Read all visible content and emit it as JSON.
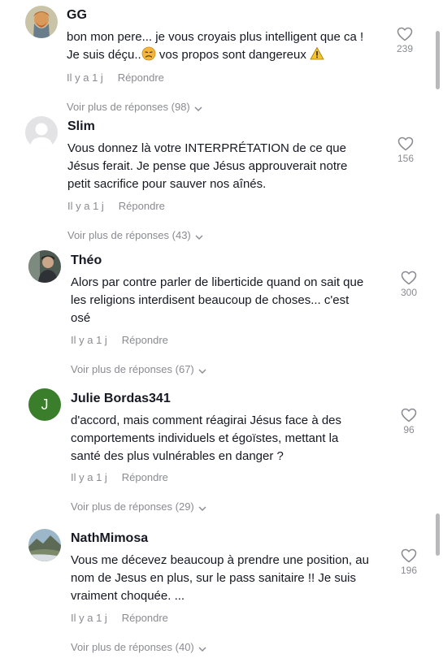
{
  "comments": [
    {
      "username": "GG",
      "line1": "bon mon pere... je vous croyais plus intelligent que ca !",
      "line2a": "Je suis déçu..",
      "line2b": " vos propos sont dangereux ",
      "emoji_1": "disappointed-face-icon",
      "emoji_2": "warning-icon",
      "time": "Il y a 1 j",
      "reply": "Répondre",
      "likes": "239",
      "more": "Voir plus de réponses (98)"
    },
    {
      "username": "Slim",
      "lines": [
        "Vous donnez là votre INTERPRÉTATION de ce que",
        "Jésus ferait. Je pense que Jésus approuverait notre",
        "petit sacrifice pour sauver nos aînés."
      ],
      "time": "Il y a 1 j",
      "reply": "Répondre",
      "likes": "156",
      "more": "Voir plus de réponses (43)"
    },
    {
      "username": "Théo",
      "lines": [
        "Alors par contre parler de liberticide quand on sait que",
        "les religions interdisent beaucoup de choses... c'est",
        "osé"
      ],
      "time": "Il y a 1 j",
      "reply": "Répondre",
      "likes": "300",
      "more": "Voir plus de réponses (67)"
    },
    {
      "username": "Julie Bordas341",
      "avatar_letter": "J",
      "lines": [
        "d'accord, mais comment réagirai Jésus face à des",
        "comportements individuels et égoïstes, mettant la",
        "santé des plus vulnérables en danger ?"
      ],
      "time": "Il y a 1 j",
      "reply": "Répondre",
      "likes": "96",
      "more": "Voir plus de réponses (29)"
    },
    {
      "username": "NathMimosa",
      "lines": [
        "Vous me décevez beaucoup à prendre une position, au",
        "nom de Jesus en plus, sur le pass sanitaire !! Je suis",
        "vraiment choquée. ..."
      ],
      "time": "Il y a 1 j",
      "reply": "Répondre",
      "likes": "196",
      "more": "Voir plus de réponses (40)"
    }
  ],
  "colors": {
    "text": "#161823",
    "muted": "#8a8b91",
    "julie_avatar": "#3a7d2a"
  }
}
